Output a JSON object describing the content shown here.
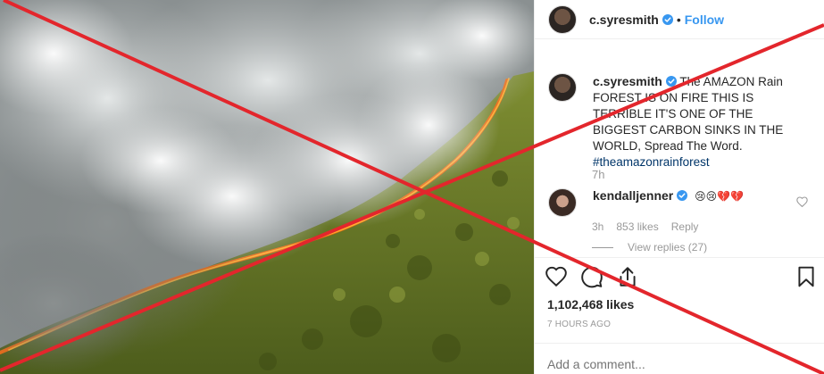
{
  "post": {
    "author": {
      "username": "c.syresmith",
      "verified": true,
      "follow_label": "Follow",
      "separator": "•"
    },
    "photo": {
      "subject": "aerial view of a forest fire with smoke over green canopy"
    },
    "caption": {
      "username": "c.syresmith",
      "text": "The AMAZON Rain FOREST IS ON FIRE THIS IS TERRIBLE IT'S ONE OF THE BIGGEST CARBON SINKS IN THE WORLD, Spread The Word.",
      "hashtag": "#theamazonrainforest",
      "time": "7h"
    },
    "comments": [
      {
        "username": "kendalljenner",
        "verified": true,
        "text": "😢😢💔💔",
        "time": "3h",
        "likes": "853 likes",
        "reply_label": "Reply",
        "view_replies": "View replies (27)"
      }
    ],
    "likes_count": "1,102,468 likes",
    "posted_ago": "7 HOURS AGO",
    "add_comment_placeholder": "Add a comment...",
    "icons": {
      "like": "heart-outline-icon",
      "comment": "comment-bubble-icon",
      "share": "share-icon",
      "save": "bookmark-icon",
      "verified": "verified-badge-icon",
      "comment_like": "heart-small-icon"
    },
    "colors": {
      "link_blue": "#3897f0",
      "hashtag": "#003569",
      "muted": "#999999",
      "cross_red": "#e3262c"
    }
  }
}
